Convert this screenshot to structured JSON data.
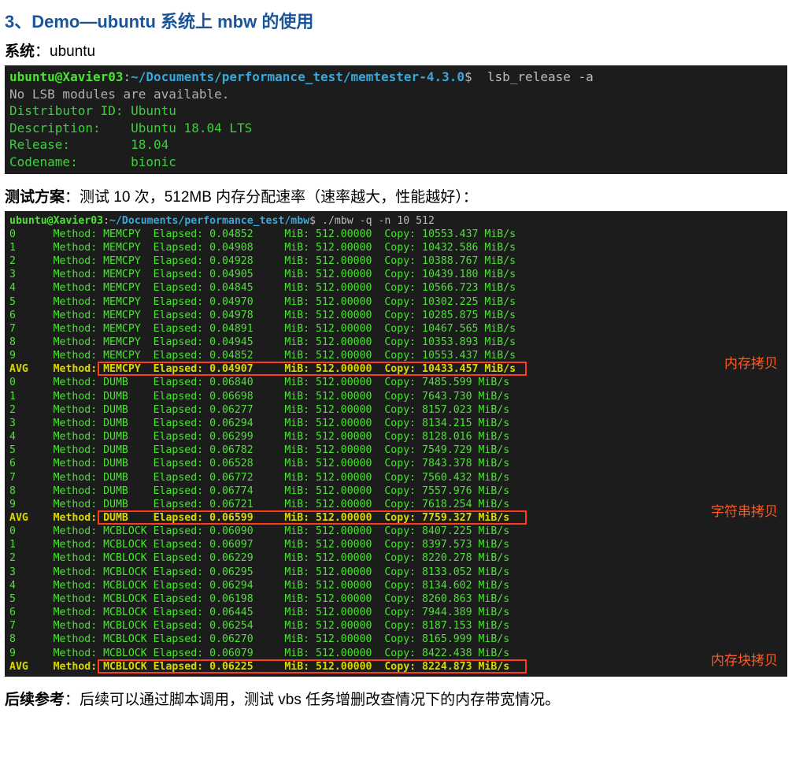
{
  "heading": "3、Demo—ubuntu 系统上 mbw 的使用",
  "system_label": "系统",
  "system_value": "：ubuntu",
  "term1": {
    "prompt_user": "ubuntu@Xavier03",
    "prompt_colon": ":",
    "prompt_path": "~/Documents/performance_test/memtester-4.3.0",
    "prompt_dollar": "$",
    "cmd": "  lsb_release -a",
    "lines": [
      "No LSB modules are available.",
      "Distributor ID: Ubuntu",
      "Description:    Ubuntu 18.04 LTS",
      "Release:        18.04",
      "Codename:       bionic"
    ]
  },
  "plan_label": "测试方案",
  "plan_value": "：测试 10 次，512MB 内存分配速率（速率越大，性能越好）：",
  "term2": {
    "prompt_user": "ubuntu@Xavier03",
    "prompt_colon": ":",
    "prompt_path": "~/Documents/performance_test/mbw",
    "prompt_dollar": "$",
    "cmd": " ./mbw -q -n 10 512",
    "rows": [
      {
        "idx": "0",
        "method": "MEMCPY",
        "elapsed": "0.04852",
        "mib": "512.00000",
        "copy": "10553.437",
        "avg": false
      },
      {
        "idx": "1",
        "method": "MEMCPY",
        "elapsed": "0.04908",
        "mib": "512.00000",
        "copy": "10432.586",
        "avg": false
      },
      {
        "idx": "2",
        "method": "MEMCPY",
        "elapsed": "0.04928",
        "mib": "512.00000",
        "copy": "10388.767",
        "avg": false
      },
      {
        "idx": "3",
        "method": "MEMCPY",
        "elapsed": "0.04905",
        "mib": "512.00000",
        "copy": "10439.180",
        "avg": false
      },
      {
        "idx": "4",
        "method": "MEMCPY",
        "elapsed": "0.04845",
        "mib": "512.00000",
        "copy": "10566.723",
        "avg": false
      },
      {
        "idx": "5",
        "method": "MEMCPY",
        "elapsed": "0.04970",
        "mib": "512.00000",
        "copy": "10302.225",
        "avg": false
      },
      {
        "idx": "6",
        "method": "MEMCPY",
        "elapsed": "0.04978",
        "mib": "512.00000",
        "copy": "10285.875",
        "avg": false
      },
      {
        "idx": "7",
        "method": "MEMCPY",
        "elapsed": "0.04891",
        "mib": "512.00000",
        "copy": "10467.565",
        "avg": false
      },
      {
        "idx": "8",
        "method": "MEMCPY",
        "elapsed": "0.04945",
        "mib": "512.00000",
        "copy": "10353.893",
        "avg": false
      },
      {
        "idx": "9",
        "method": "MEMCPY",
        "elapsed": "0.04852",
        "mib": "512.00000",
        "copy": "10553.437",
        "avg": false
      },
      {
        "idx": "AVG",
        "method": "MEMCPY",
        "elapsed": "0.04907",
        "mib": "512.00000",
        "copy": "10433.457",
        "avg": true
      },
      {
        "idx": "0",
        "method": "DUMB",
        "elapsed": "0.06840",
        "mib": "512.00000",
        "copy": "7485.599",
        "avg": false
      },
      {
        "idx": "1",
        "method": "DUMB",
        "elapsed": "0.06698",
        "mib": "512.00000",
        "copy": "7643.730",
        "avg": false
      },
      {
        "idx": "2",
        "method": "DUMB",
        "elapsed": "0.06277",
        "mib": "512.00000",
        "copy": "8157.023",
        "avg": false
      },
      {
        "idx": "3",
        "method": "DUMB",
        "elapsed": "0.06294",
        "mib": "512.00000",
        "copy": "8134.215",
        "avg": false
      },
      {
        "idx": "4",
        "method": "DUMB",
        "elapsed": "0.06299",
        "mib": "512.00000",
        "copy": "8128.016",
        "avg": false
      },
      {
        "idx": "5",
        "method": "DUMB",
        "elapsed": "0.06782",
        "mib": "512.00000",
        "copy": "7549.729",
        "avg": false
      },
      {
        "idx": "6",
        "method": "DUMB",
        "elapsed": "0.06528",
        "mib": "512.00000",
        "copy": "7843.378",
        "avg": false
      },
      {
        "idx": "7",
        "method": "DUMB",
        "elapsed": "0.06772",
        "mib": "512.00000",
        "copy": "7560.432",
        "avg": false
      },
      {
        "idx": "8",
        "method": "DUMB",
        "elapsed": "0.06774",
        "mib": "512.00000",
        "copy": "7557.976",
        "avg": false
      },
      {
        "idx": "9",
        "method": "DUMB",
        "elapsed": "0.06721",
        "mib": "512.00000",
        "copy": "7618.254",
        "avg": false
      },
      {
        "idx": "AVG",
        "method": "DUMB",
        "elapsed": "0.06599",
        "mib": "512.00000",
        "copy": "7759.327",
        "avg": true
      },
      {
        "idx": "0",
        "method": "MCBLOCK",
        "elapsed": "0.06090",
        "mib": "512.00000",
        "copy": "8407.225",
        "avg": false
      },
      {
        "idx": "1",
        "method": "MCBLOCK",
        "elapsed": "0.06097",
        "mib": "512.00000",
        "copy": "8397.573",
        "avg": false
      },
      {
        "idx": "2",
        "method": "MCBLOCK",
        "elapsed": "0.06229",
        "mib": "512.00000",
        "copy": "8220.278",
        "avg": false
      },
      {
        "idx": "3",
        "method": "MCBLOCK",
        "elapsed": "0.06295",
        "mib": "512.00000",
        "copy": "8133.052",
        "avg": false
      },
      {
        "idx": "4",
        "method": "MCBLOCK",
        "elapsed": "0.06294",
        "mib": "512.00000",
        "copy": "8134.602",
        "avg": false
      },
      {
        "idx": "5",
        "method": "MCBLOCK",
        "elapsed": "0.06198",
        "mib": "512.00000",
        "copy": "8260.863",
        "avg": false
      },
      {
        "idx": "6",
        "method": "MCBLOCK",
        "elapsed": "0.06445",
        "mib": "512.00000",
        "copy": "7944.389",
        "avg": false
      },
      {
        "idx": "7",
        "method": "MCBLOCK",
        "elapsed": "0.06254",
        "mib": "512.00000",
        "copy": "8187.153",
        "avg": false
      },
      {
        "idx": "8",
        "method": "MCBLOCK",
        "elapsed": "0.06270",
        "mib": "512.00000",
        "copy": "8165.999",
        "avg": false
      },
      {
        "idx": "9",
        "method": "MCBLOCK",
        "elapsed": "0.06079",
        "mib": "512.00000",
        "copy": "8422.438",
        "avg": false
      },
      {
        "idx": "AVG",
        "method": "MCBLOCK",
        "elapsed": "0.06225",
        "mib": "512.00000",
        "copy": "8224.873",
        "avg": true
      }
    ],
    "annotations": {
      "memcpy": "内存拷贝",
      "dumb": "字符串拷贝",
      "mcblock": "内存块拷贝"
    }
  },
  "followup_label": "后续参考",
  "followup_value": "：后续可以通过脚本调用，测试 vbs 任务增删改查情况下的内存带宽情况。"
}
